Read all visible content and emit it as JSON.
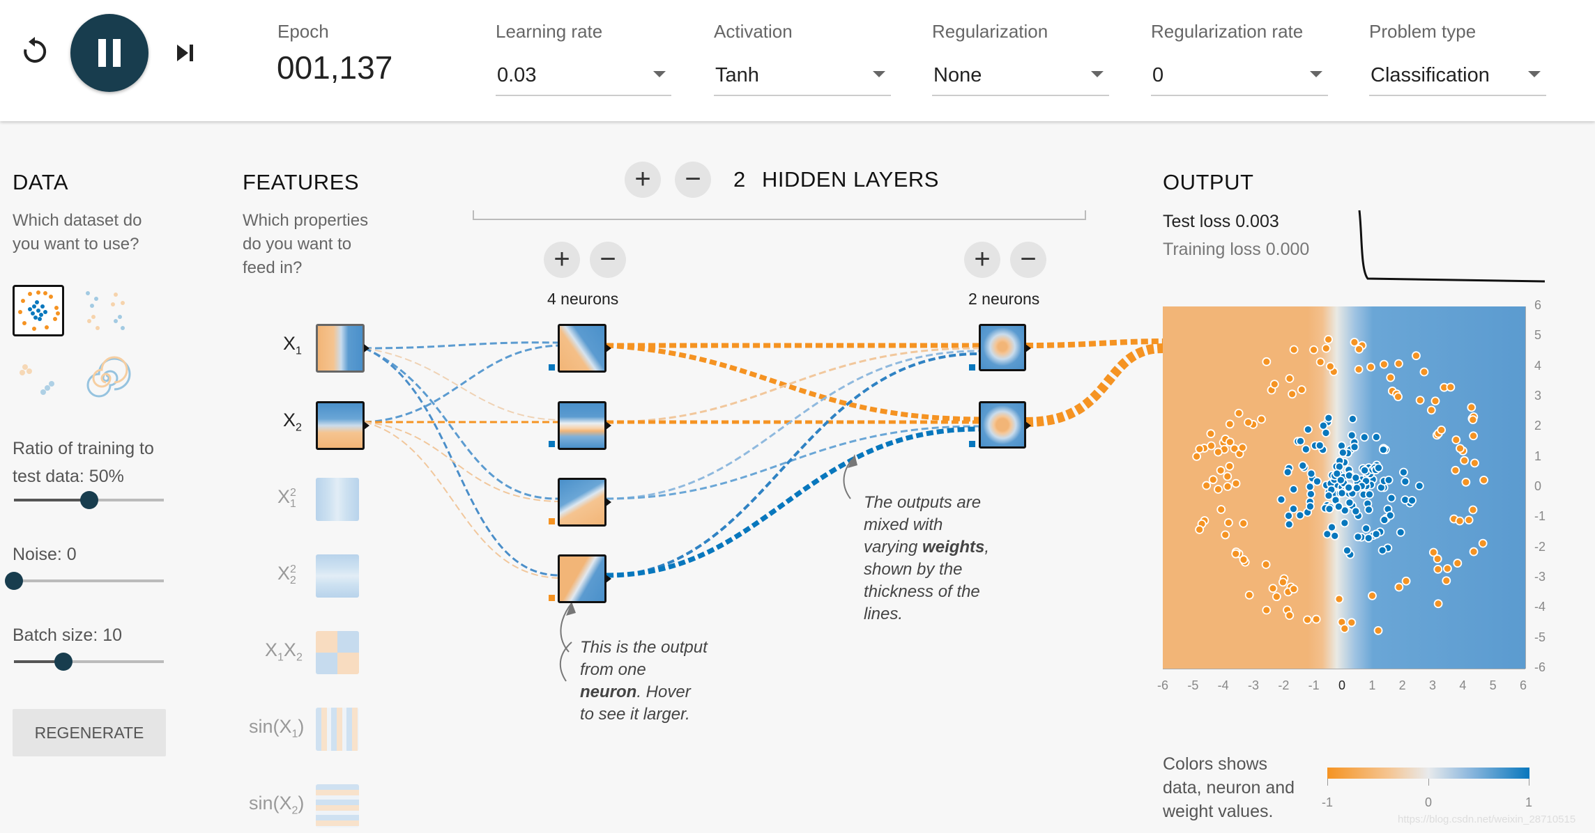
{
  "toolbar": {
    "epoch_label": "Epoch",
    "epoch_value": "001,137",
    "learning_rate": {
      "label": "Learning rate",
      "value": "0.03"
    },
    "activation": {
      "label": "Activation",
      "value": "Tanh"
    },
    "regularization": {
      "label": "Regularization",
      "value": "None"
    },
    "regularization_rate": {
      "label": "Regularization rate",
      "value": "0"
    },
    "problem_type": {
      "label": "Problem type",
      "value": "Classification"
    }
  },
  "data_panel": {
    "title": "DATA",
    "question": [
      "Which dataset do",
      "you want to use?"
    ],
    "ratio_label": [
      "Ratio of training to",
      "test data:  50%"
    ],
    "ratio_value": 0.5,
    "noise_label": "Noise:  0",
    "noise_value": 0,
    "batch_label": "Batch size:  10",
    "batch_value": 0.33,
    "regenerate_label": "REGENERATE"
  },
  "features_panel": {
    "title": "FEATURES",
    "question": [
      "Which properties",
      "do you want to",
      "feed in?"
    ]
  },
  "network": {
    "hidden_layers_count": "2",
    "hidden_layers_label": "HIDDEN LAYERS",
    "layer1_neurons": "4 neurons",
    "layer2_neurons": "2 neurons"
  },
  "annotations": {
    "neuron_note": [
      "This is the output",
      "from one",
      "neuron",
      ". Hover",
      "to see it larger."
    ],
    "weights_note": [
      "The outputs are",
      "mixed with",
      "varying ",
      "weights",
      ",",
      "shown by the",
      "thickness of the",
      "lines."
    ]
  },
  "output_panel": {
    "title": "OUTPUT",
    "test_loss": "Test loss 0.003",
    "training_loss": "Training loss 0.000",
    "y_ticks": [
      "6",
      "5",
      "4",
      "3",
      "2",
      "1",
      "0",
      "-1",
      "-2",
      "-3",
      "-4",
      "-5",
      "-6"
    ],
    "x_ticks": [
      "-6",
      "-5",
      "-4",
      "-3",
      "-2",
      "-1",
      "0",
      "1",
      "2",
      "3",
      "4",
      "5",
      "6"
    ],
    "legend_text": [
      "Colors shows",
      "data, neuron and",
      "weight values."
    ],
    "legend_ticks": [
      "-1",
      "0",
      "1"
    ]
  },
  "colors": {
    "orange": "#f59322",
    "blue": "#0877bd",
    "dark": "#183d4e"
  },
  "watermark": "https://blog.csdn.net/weixin_28710515"
}
